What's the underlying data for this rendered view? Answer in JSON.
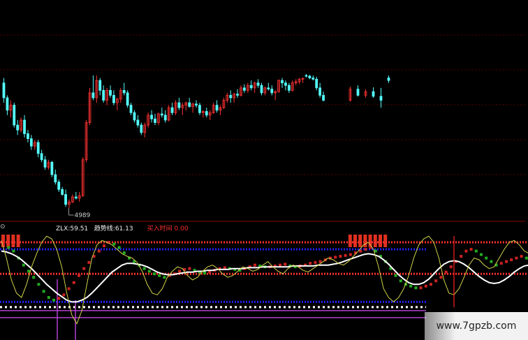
{
  "chart_data": [
    {
      "type": "candlestick",
      "colors": {
        "up": "#ff3333",
        "down": "#54fcfc",
        "grid": "#7a0000"
      },
      "low_marker": "4989",
      "gap_segments": [
        {
          "start": 105,
          "label": ""
        },
        {
          "start": 125,
          "label": ""
        }
      ],
      "ohlc": [
        [
          5200,
          5220,
          5120,
          5140
        ],
        [
          5140,
          5150,
          5070,
          5090
        ],
        [
          5090,
          5130,
          5060,
          5110
        ],
        [
          5110,
          5120,
          5020,
          5030
        ],
        [
          5030,
          5050,
          4990,
          5010
        ],
        [
          5010,
          5060,
          5000,
          5050
        ],
        [
          5050,
          5070,
          4980,
          4995
        ],
        [
          4995,
          5010,
          4960,
          4975
        ],
        [
          4975,
          4990,
          4930,
          4945
        ],
        [
          4945,
          4970,
          4930,
          4960
        ],
        [
          4960,
          4970,
          4900,
          4915
        ],
        [
          4915,
          4930,
          4880,
          4890
        ],
        [
          4890,
          4905,
          4850,
          4860
        ],
        [
          4860,
          4890,
          4850,
          4880
        ],
        [
          4880,
          4885,
          4820,
          4830
        ],
        [
          4830,
          4850,
          4790,
          4800
        ],
        [
          4800,
          4810,
          4760,
          4770
        ],
        [
          4770,
          4780,
          4745,
          4750
        ],
        [
          4750,
          4770,
          4700,
          4710
        ],
        [
          4710,
          4730,
          4695,
          4720
        ],
        [
          4720,
          4750,
          4715,
          4740
        ],
        [
          4740,
          4760,
          4730,
          4735
        ],
        [
          4735,
          4760,
          4720,
          4745
        ],
        [
          4745,
          4900,
          4740,
          4890
        ],
        [
          4890,
          5050,
          4880,
          5040
        ],
        [
          5040,
          5180,
          5030,
          5160
        ],
        [
          5160,
          5230,
          5130,
          5140
        ],
        [
          5140,
          5230,
          5120,
          5210
        ],
        [
          5210,
          5220,
          5150,
          5170
        ],
        [
          5170,
          5190,
          5120,
          5130
        ],
        [
          5130,
          5180,
          5110,
          5170
        ],
        [
          5170,
          5190,
          5140,
          5150
        ],
        [
          5150,
          5170,
          5110,
          5120
        ],
        [
          5120,
          5140,
          5090,
          5135
        ],
        [
          5135,
          5180,
          5120,
          5170
        ],
        [
          5170,
          5200,
          5150,
          5160
        ],
        [
          5160,
          5170,
          5100,
          5110
        ],
        [
          5110,
          5120,
          5070,
          5080
        ],
        [
          5080,
          5090,
          5040,
          5050
        ],
        [
          5050,
          5070,
          5020,
          5030
        ],
        [
          5030,
          5040,
          4990,
          5000
        ],
        [
          5000,
          5040,
          4980,
          5030
        ],
        [
          5030,
          5080,
          5020,
          5070
        ],
        [
          5070,
          5090,
          5040,
          5055
        ],
        [
          5055,
          5075,
          5030,
          5040
        ],
        [
          5040,
          5080,
          5030,
          5075
        ],
        [
          5075,
          5100,
          5060,
          5070
        ],
        [
          5070,
          5090,
          5040,
          5050
        ],
        [
          5050,
          5110,
          5045,
          5100
        ],
        [
          5100,
          5120,
          5070,
          5080
        ],
        [
          5080,
          5130,
          5070,
          5120
        ],
        [
          5120,
          5140,
          5090,
          5100
        ],
        [
          5100,
          5120,
          5070,
          5110
        ],
        [
          5110,
          5125,
          5090,
          5120
        ],
        [
          5120,
          5140,
          5100,
          5105
        ],
        [
          5105,
          5120,
          5080,
          5115
        ],
        [
          5115,
          5130,
          5100,
          5110
        ],
        [
          5110,
          5120,
          5070,
          5080
        ],
        [
          5080,
          5090,
          5060,
          5085
        ],
        [
          5085,
          5100,
          5060,
          5070
        ],
        [
          5070,
          5090,
          5050,
          5080
        ],
        [
          5080,
          5120,
          5075,
          5110
        ],
        [
          5110,
          5130,
          5080,
          5090
        ],
        [
          5090,
          5110,
          5070,
          5100
        ],
        [
          5100,
          5140,
          5095,
          5130
        ],
        [
          5130,
          5160,
          5120,
          5150
        ],
        [
          5150,
          5170,
          5120,
          5140
        ],
        [
          5140,
          5160,
          5120,
          5155
        ],
        [
          5155,
          5175,
          5140,
          5150
        ],
        [
          5150,
          5190,
          5145,
          5180
        ],
        [
          5180,
          5195,
          5160,
          5170
        ],
        [
          5170,
          5200,
          5160,
          5190
        ],
        [
          5190,
          5210,
          5170,
          5180
        ],
        [
          5180,
          5205,
          5160,
          5200
        ],
        [
          5200,
          5215,
          5180,
          5190
        ],
        [
          5190,
          5200,
          5150,
          5160
        ],
        [
          5160,
          5185,
          5150,
          5180
        ],
        [
          5180,
          5200,
          5170,
          5175
        ],
        [
          5175,
          5190,
          5150,
          5160
        ],
        [
          5160,
          5170,
          5130,
          5165
        ],
        [
          5165,
          5215,
          5160,
          5210
        ],
        [
          5210,
          5220,
          5180,
          5200
        ],
        [
          5200,
          5210,
          5170,
          5190
        ],
        [
          5190,
          5200,
          5160,
          5170
        ],
        [
          5170,
          5210,
          5165,
          5200
        ],
        [
          5200,
          5215,
          5190,
          5205
        ],
        [
          5205,
          5220,
          5195,
          5215
        ],
        [
          5215,
          5222,
          5200,
          5218
        ],
        [
          5230,
          5236,
          5222,
          5228
        ],
        [
          5228,
          5232,
          5215,
          5220
        ],
        [
          5220,
          5230,
          5210,
          5215
        ],
        [
          5215,
          5225,
          5170,
          5180
        ],
        [
          5180,
          5200,
          5140,
          5150
        ],
        [
          5150,
          5165,
          5125,
          5130
        ],
        [
          5130,
          5185,
          5125,
          5175
        ],
        [
          5175,
          5190,
          5145,
          5150
        ],
        [
          5150,
          5175,
          5140,
          5165
        ],
        [
          5165,
          5182,
          5140,
          5146
        ],
        [
          5146,
          5180,
          5100,
          5130
        ],
        [
          5220,
          5230,
          5200,
          5210
        ]
      ]
    },
    {
      "type": "indicator",
      "legend": [
        {
          "label": "ZLX:",
          "value": "59.51",
          "color": "#f0f0f0"
        },
        {
          "label": "趋势线:",
          "value": "61.13",
          "color": "#f0f0f0"
        },
        {
          "label": "",
          "value": "",
          "color": "#4060ff"
        },
        {
          "label": "",
          "value": "",
          "color": "#ff3030"
        },
        {
          "label": "",
          "value": "",
          "color": "#ff30ff"
        },
        {
          "label": "买入时间",
          "value": "0.00",
          "color": "#ff3030"
        }
      ],
      "title": "",
      "colors": {
        "zlx": "#d2d24a",
        "trend": "#ffffff",
        "bar_up": "#cc2222",
        "bar_down": "#22aa22",
        "line_red": "#ff3030",
        "line_blue": "#2020ff",
        "line_white": "#ffffff",
        "purple": "#b040d0",
        "spike": "#ff2020"
      },
      "zlx": [
        90,
        70,
        45,
        30,
        25,
        40,
        60,
        75,
        88,
        95,
        92,
        80,
        60,
        30,
        5,
        -5,
        10,
        40,
        70,
        85,
        90,
        88,
        85,
        80,
        75,
        72,
        70,
        65,
        55,
        40,
        30,
        28,
        35,
        48,
        55,
        60,
        58,
        50,
        45,
        48,
        55,
        60,
        62,
        58,
        52,
        48,
        50,
        55,
        60,
        58,
        55,
        57,
        62,
        66,
        60,
        55,
        52,
        58,
        62,
        60,
        56,
        54,
        58,
        62,
        66,
        70,
        68,
        64,
        62,
        66,
        72,
        78,
        85,
        88,
        80,
        60,
        35,
        25,
        20,
        25,
        35,
        50,
        70,
        85,
        92,
        95,
        88,
        70,
        45,
        30,
        28,
        35,
        48,
        62,
        70,
        68,
        62,
        58,
        60,
        70,
        80,
        88,
        90,
        85,
        78,
        75
      ],
      "trend": [
        78,
        77,
        75,
        72,
        68,
        63,
        58,
        52,
        46,
        40,
        35,
        30,
        26,
        22,
        20,
        20,
        22,
        25,
        30,
        36,
        42,
        48,
        54,
        58,
        62,
        64,
        64,
        63,
        62,
        60,
        57,
        54,
        52,
        51,
        51,
        52,
        53,
        54,
        54,
        55,
        55,
        56,
        56,
        57,
        57,
        57,
        58,
        58,
        58,
        59,
        59,
        59,
        60,
        60,
        60,
        60,
        60,
        60,
        61,
        61,
        61,
        61,
        61,
        62,
        62,
        62,
        63,
        64,
        66,
        68,
        70,
        72,
        74,
        75,
        74,
        72,
        68,
        63,
        57,
        51,
        46,
        42,
        40,
        40,
        42,
        46,
        52,
        58,
        63,
        66,
        67,
        66,
        63,
        59,
        54,
        49,
        45,
        42,
        41,
        42,
        45,
        49,
        54,
        58,
        61,
        62
      ],
      "bars": [
        85,
        82,
        78,
        70,
        62,
        55,
        48,
        40,
        32,
        25,
        22,
        24,
        28,
        35,
        42,
        50,
        58,
        65,
        72,
        78,
        84,
        88,
        86,
        82,
        76,
        70,
        66,
        62,
        58,
        55,
        52,
        50,
        48,
        50,
        52,
        55,
        57,
        58,
        56,
        54,
        53,
        54,
        56,
        58,
        59,
        58,
        57,
        56,
        58,
        60,
        62,
        61,
        60,
        60,
        61,
        62,
        63,
        61,
        60,
        61,
        62,
        64,
        65,
        66,
        68,
        70,
        71,
        72,
        73,
        74,
        76,
        78,
        80,
        82,
        78,
        72,
        66,
        58,
        50,
        44,
        40,
        38,
        36,
        36,
        38,
        40,
        44,
        48,
        54,
        60,
        66,
        72,
        78,
        80,
        78,
        74,
        70,
        66,
        62,
        64,
        66,
        68,
        70,
        72,
        70,
        68
      ],
      "red_dots": [
        88,
        52
      ],
      "blue_dots": [
        80,
        20
      ],
      "white_dots": 14,
      "purple_lines": [
        10,
        2
      ],
      "spike_index": 90,
      "top_blocks": [
        [
          0,
          3
        ],
        [
          69,
          76
        ]
      ]
    }
  ],
  "watermark": "www.7gpzb.com"
}
